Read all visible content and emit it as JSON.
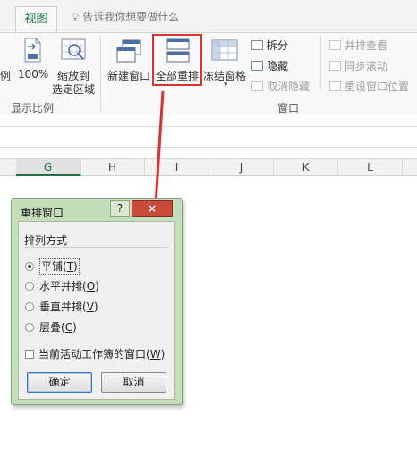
{
  "ribbon": {
    "active_tab": "视图",
    "tell_me": "告诉我你想要做什么",
    "zoom_group": {
      "partial_label": "例",
      "zoom100": "100%",
      "zoom_selection_line1": "缩放到",
      "zoom_selection_line2": "选定区域",
      "group_label": "显示比例"
    },
    "window_group": {
      "new_window": "新建窗口",
      "arrange_all": "全部重排",
      "freeze_panes": "冻结窗格",
      "split": "拆分",
      "hide": "隐藏",
      "unhide": "取消隐藏",
      "side_by_side": "并排查看",
      "sync_scroll": "同步滚动",
      "reset_position": "重设窗口位置",
      "group_label": "窗口"
    }
  },
  "sheet": {
    "columns": [
      "G",
      "H",
      "I",
      "J",
      "K",
      "L"
    ],
    "selected_column": "G"
  },
  "dialog": {
    "title": "重排窗口",
    "help_button": "?",
    "close_button": "×",
    "group_title": "排列方式",
    "options": [
      {
        "label": "平铺",
        "key": "T",
        "selected": true
      },
      {
        "label": "水平并排",
        "key": "O",
        "selected": false
      },
      {
        "label": "垂直并排",
        "key": "V",
        "selected": false
      },
      {
        "label": "层叠",
        "key": "C",
        "selected": false
      }
    ],
    "checkbox_label": "当前活动工作簿的窗口",
    "checkbox_key": "W",
    "checkbox_checked": false,
    "ok": "确定",
    "cancel": "取消"
  },
  "colors": {
    "accent": "#217346",
    "highlight": "#d9342b",
    "dialog_frame": "#c6ddb9"
  }
}
